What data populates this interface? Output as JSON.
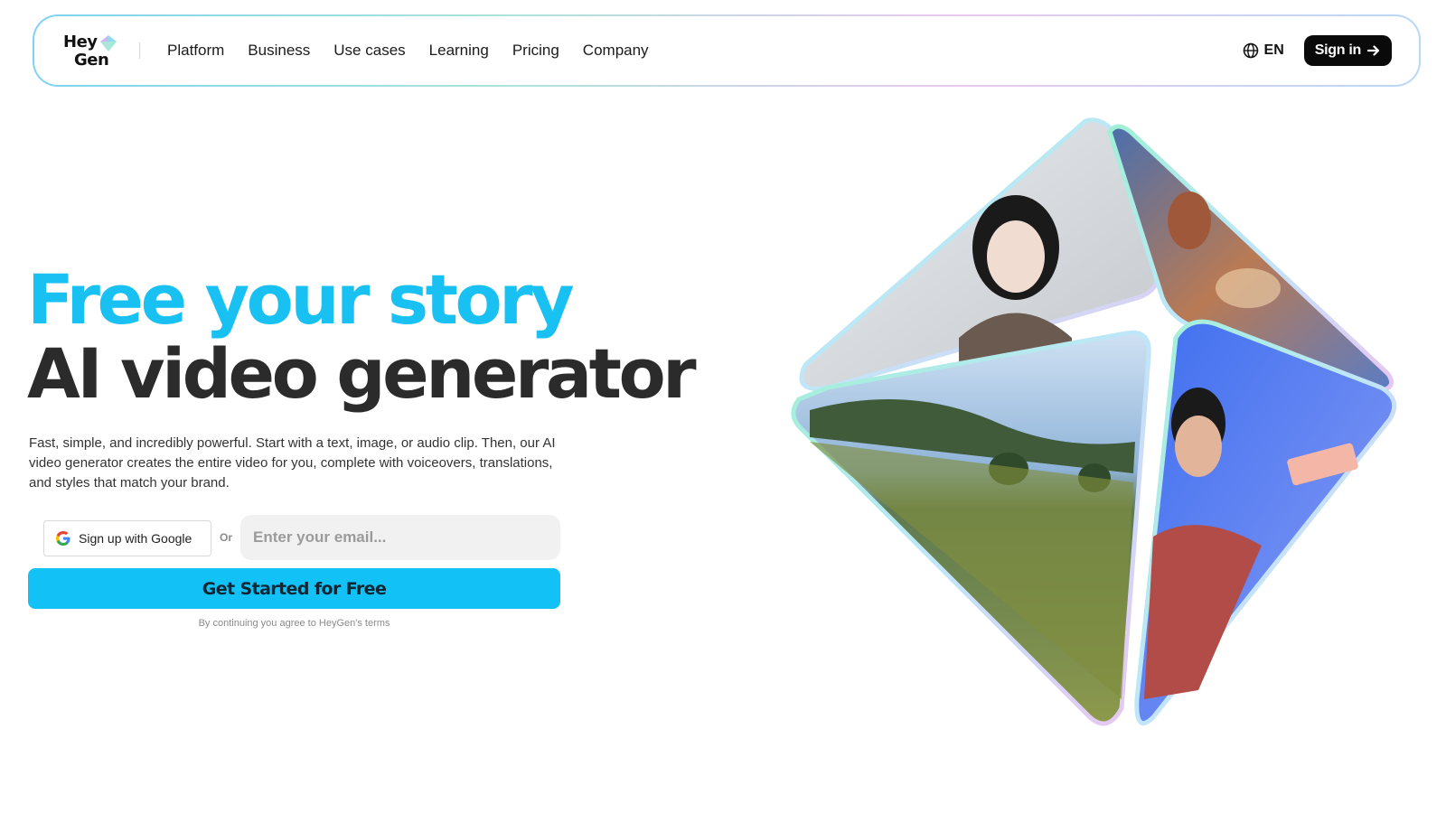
{
  "nav": {
    "logo_line1": "Hey",
    "logo_line2": "Gen",
    "items": [
      {
        "label": "Platform"
      },
      {
        "label": "Business"
      },
      {
        "label": "Use cases"
      },
      {
        "label": "Learning"
      },
      {
        "label": "Pricing"
      },
      {
        "label": "Company"
      }
    ],
    "language": "EN",
    "signin_label": "Sign in",
    "icons": {
      "language": "globe-icon",
      "signin": "arrow-right-icon"
    }
  },
  "hero": {
    "title_line1": "Free your story",
    "title_line2": "AI video generator",
    "description": "Fast, simple, and incredibly powerful. Start with a text, image, or audio clip. Then, our AI video generator creates the entire video for you, complete with voiceovers, translations, and styles that match your brand.",
    "google_button_label": "Sign up with Google",
    "or_text": "Or",
    "email_placeholder": "Enter your email...",
    "cta_label": "Get Started for Free",
    "terms_text": "By continuing you agree to HeyGen's terms"
  },
  "colors": {
    "accent": "#19c0f2",
    "cta": "#12c2f6",
    "dark": "#0a0a0a",
    "heading": "#2b2b2b"
  }
}
